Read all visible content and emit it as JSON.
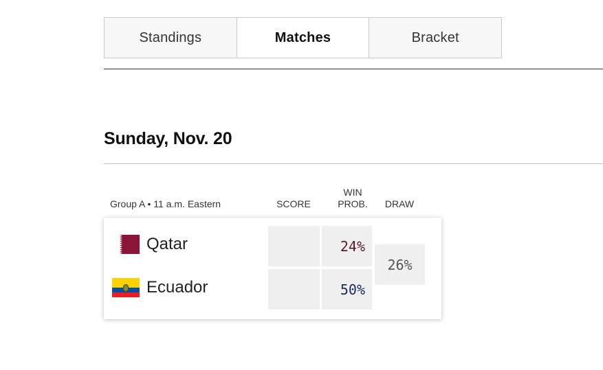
{
  "tabs": [
    {
      "label": "Standings",
      "active": false
    },
    {
      "label": "Matches",
      "active": true
    },
    {
      "label": "Bracket",
      "active": false
    }
  ],
  "date_heading": "Sunday, Nov. 20",
  "columns": {
    "score": "SCORE",
    "win_prob_line1": "WIN",
    "win_prob_line2": "PROB.",
    "draw": "DRAW"
  },
  "match": {
    "group_info": "Group A • 11 a.m. Eastern",
    "teams": [
      {
        "name": "Qatar",
        "flag": "qatar-flag-icon",
        "score": "",
        "win_prob": "24%",
        "prob_color": "#5a1a24"
      },
      {
        "name": "Ecuador",
        "flag": "ecuador-flag-icon",
        "score": "",
        "win_prob": "50%",
        "prob_color": "#1c2a5a"
      }
    ],
    "draw_prob": "26%",
    "draw_color": "#555555"
  }
}
